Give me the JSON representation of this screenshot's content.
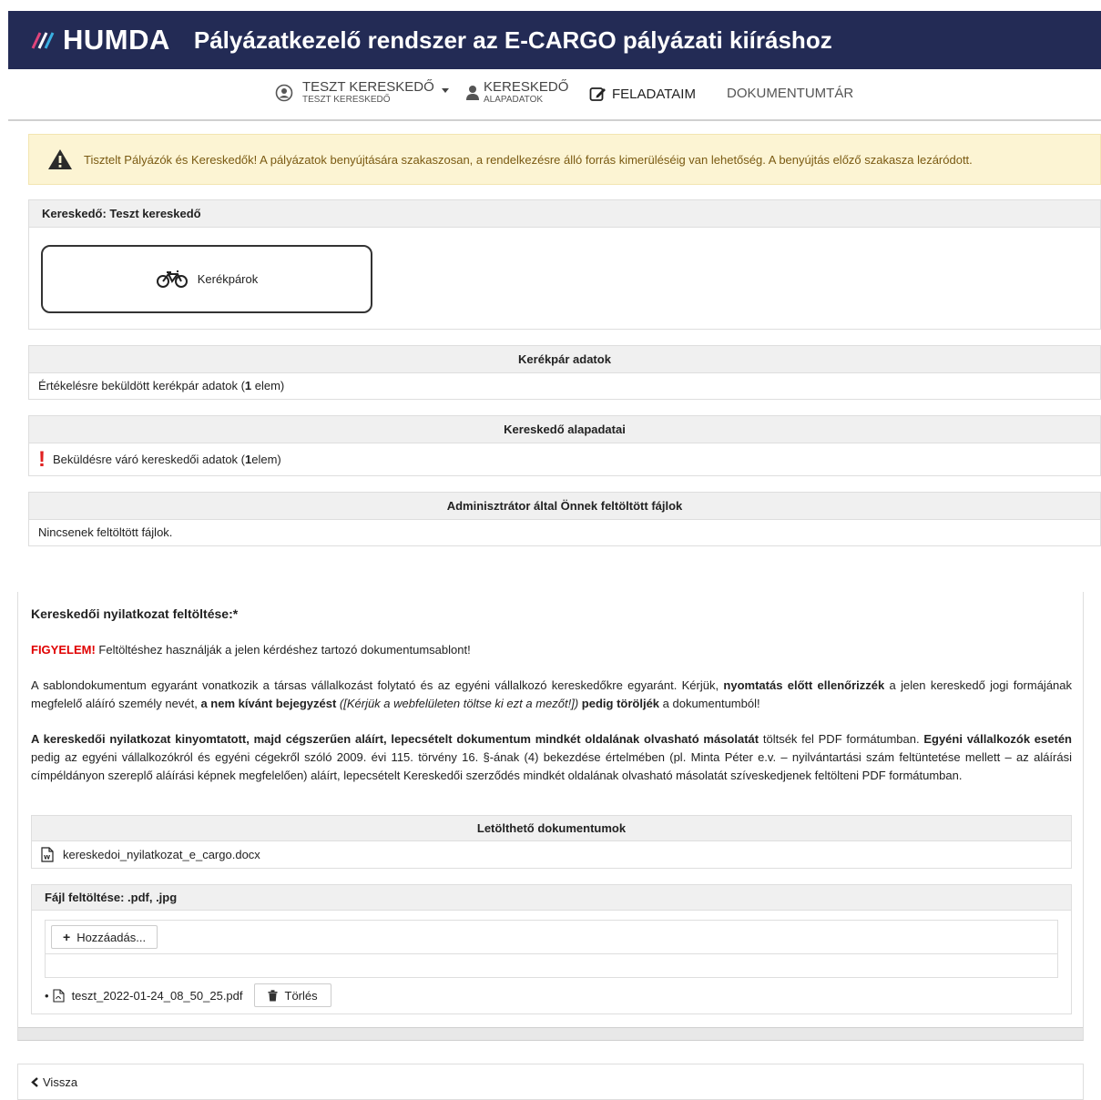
{
  "header": {
    "logo": "HUMDA",
    "title": "Pályázatkezelő rendszer az E-CARGO pályázati kiíráshoz",
    "brand_color": "#232b55"
  },
  "nav": {
    "user_name": "TESZT KERESKEDŐ",
    "user_sub": "TESZT KERESKEDŐ",
    "merchant_main": "KERESKEDŐ",
    "merchant_sub": "ALAPADATOK",
    "tasks": "FELADATAIM",
    "docs": "DOKUMENTUMTÁR"
  },
  "alert": {
    "text": "Tisztelt Pályázók és Kereskedők! A pályázatok benyújtására szakaszosan, a rendelkezésre álló forrás kimerüléséig van lehetőség. A benyújtás előző szakasza lezáródott."
  },
  "merchant_panel": {
    "title": "Kereskedő: Teszt kereskedő",
    "category": "Kerékpárok"
  },
  "bike_data": {
    "title": "Kerékpár adatok",
    "text_before": "Értékelésre beküldött kerékpár adatok (",
    "count": "1",
    "text_after": " elem)"
  },
  "merchant_basic": {
    "title": "Kereskedő alapadatai",
    "text_before": "Beküldésre váró kereskedői adatok (",
    "count": "1",
    "text_after": " elem)"
  },
  "admin_files": {
    "title": "Adminisztrátor által Önnek feltöltött fájlok",
    "empty": "Nincsenek feltöltött fájlok."
  },
  "declaration": {
    "title": "Kereskedői nyilatkozat feltöltése:*",
    "warning_label": "FIGYELEM!",
    "warning_text": " Feltöltéshez használják a jelen kérdéshez tartozó dokumentumsablont!",
    "p2_a": "A sablondokumentum egyaránt vonatkozik a társas vállalkozást folytató és az egyéni vállalkozó kereskedőkre egyaránt. Kérjük, ",
    "p2_b": "nyomtatás előtt ellenőrizzék",
    "p2_c": " a jelen kereskedő jogi formájának megfelelő aláíró személy nevét, ",
    "p2_d": "a nem kívánt bejegyzést",
    "p2_e": " ([Kérjük a webfelületen töltse ki ezt a mezőt!])",
    "p2_f": " pedig töröljék",
    "p2_g": " a dokumentumból!",
    "p3_a": "A kereskedői nyilatkozat kinyomtatott, majd cégszerűen aláírt, lepecsételt dokumentum mindkét oldalának olvasható másolatát",
    "p3_b": " töltsék fel PDF formátumban. ",
    "p3_c": "Egyéni vállalkozók esetén",
    "p3_d": " pedig az egyéni vállalkozókról és egyéni cégekről szóló 2009. évi 115. törvény 16. §-ának (4) bekezdése értelmében (pl. Minta Péter e.v. – nyilvántartási szám feltüntetése mellett – az aláírási címpéldányon szereplő aláírási képnek megfelelően) aláírt, lepecsételt Kereskedői szerződés mindkét oldalának olvasható másolatát szíveskedjenek feltölteni PDF formátumban."
  },
  "downloads": {
    "title": "Letölthető dokumentumok",
    "file": "kereskedoi_nyilatkozat_e_cargo.docx"
  },
  "upload": {
    "title": "Fájl feltöltése: .pdf, .jpg",
    "add_label": "Hozzáadás...",
    "uploaded_file": "teszt_2022-01-24_08_50_25.pdf",
    "delete_label": "Törlés"
  },
  "back": {
    "label": "Vissza"
  }
}
